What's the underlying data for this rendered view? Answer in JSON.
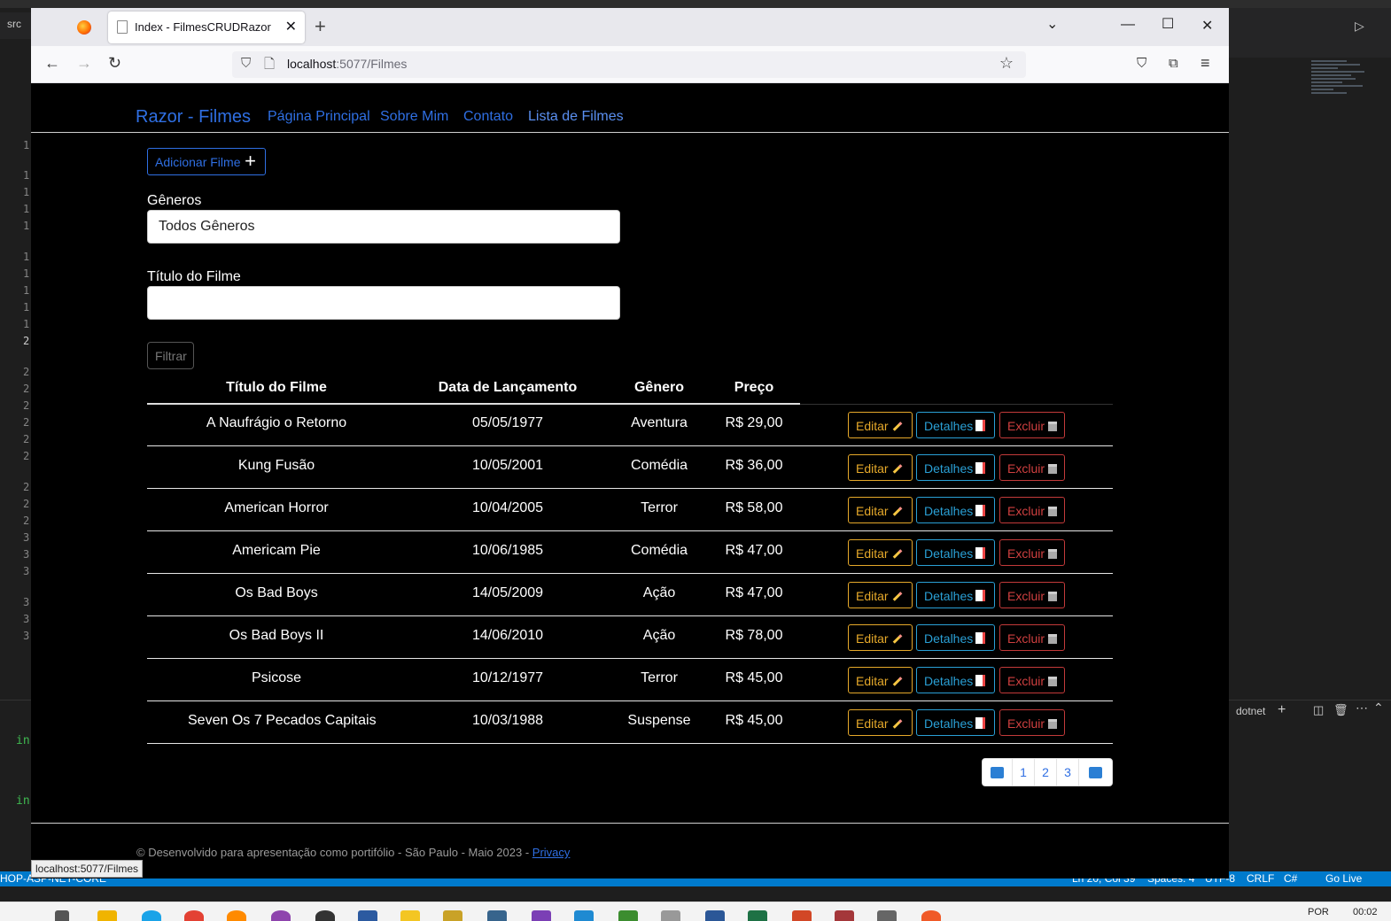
{
  "browser": {
    "tab_title": "Index - FilmesCRUDRazor",
    "url_host": "localhost",
    "url_rest": ":5077/Filmes",
    "status_tooltip": "localhost:5077/Filmes"
  },
  "site": {
    "brand": "Razor - Filmes",
    "nav": [
      "Página Principal",
      "Sobre Mim",
      "Contato",
      "Lista de Filmes"
    ]
  },
  "actions": {
    "add_label": "Adicionar Filme",
    "filter_label": "Filtrar"
  },
  "filters": {
    "genre_label": "Gêneros",
    "genre_value": "Todos Gêneros",
    "title_label": "Título do Filme",
    "title_value": ""
  },
  "table": {
    "headers": [
      "Título do Filme",
      "Data de Lançamento",
      "Gênero",
      "Preço"
    ],
    "edit_label": "Editar",
    "details_label": "Detalhes",
    "delete_label": "Excluir",
    "rows": [
      {
        "title": "A Naufrágio o Retorno",
        "date": "05/05/1977",
        "genre": "Aventura",
        "price": "R$ 29,00"
      },
      {
        "title": "Kung Fusão",
        "date": "10/05/2001",
        "genre": "Comédia",
        "price": "R$ 36,00"
      },
      {
        "title": "American Horror",
        "date": "10/04/2005",
        "genre": "Terror",
        "price": "R$ 58,00"
      },
      {
        "title": "Americam Pie",
        "date": "10/06/1985",
        "genre": "Comédia",
        "price": "R$ 47,00"
      },
      {
        "title": "Os Bad Boys",
        "date": "14/05/2009",
        "genre": "Ação",
        "price": "R$ 47,00"
      },
      {
        "title": "Os Bad Boys II",
        "date": "14/06/2010",
        "genre": "Ação",
        "price": "R$ 78,00"
      },
      {
        "title": "Psicose",
        "date": "10/12/1977",
        "genre": "Terror",
        "price": "R$ 45,00"
      },
      {
        "title": "Seven Os 7 Pecados Capitais",
        "date": "10/03/1988",
        "genre": "Suspense",
        "price": "R$ 45,00"
      }
    ]
  },
  "pagination": {
    "pages": [
      "1",
      "2",
      "3"
    ]
  },
  "footer": {
    "text": "© Desenvolvido para apresentação como portifólio - São Paulo - Maio 2023 - ",
    "link": "Privacy"
  },
  "vscode": {
    "status_items": [
      "HOP-ASP-NET-CORE",
      "Ln 20, Col 39",
      "Spaces: 4",
      "UTF-8",
      "CRLF",
      "C#",
      "Go Live"
    ],
    "panel_label": "dotnet",
    "tab_label": "src"
  },
  "taskbar": {
    "lang": "POR",
    "time": "00:02"
  },
  "colors": {
    "link": "#2f6fe3",
    "edit": "#e6a92a",
    "details": "#2aa0d6",
    "delete": "#d04040"
  }
}
